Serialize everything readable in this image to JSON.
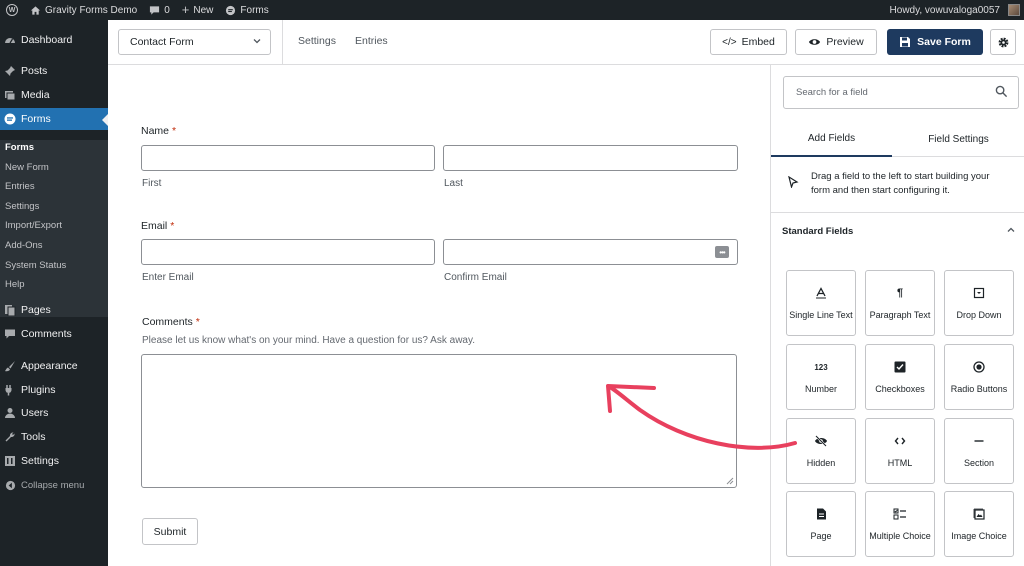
{
  "adminbar": {
    "site_name": "Gravity Forms Demo",
    "comments_count": "0",
    "new_label": "New",
    "forms_label": "Forms",
    "howdy": "Howdy, vowuvaloga0057"
  },
  "sidebar": {
    "items": [
      {
        "label": "Dashboard",
        "icon": "dashboard-icon"
      },
      {
        "label": "Posts",
        "icon": "pin-icon"
      },
      {
        "label": "Media",
        "icon": "media-icon"
      },
      {
        "label": "Forms",
        "icon": "forms-icon"
      },
      {
        "label": "Pages",
        "icon": "page-icon"
      },
      {
        "label": "Comments",
        "icon": "comment-icon"
      },
      {
        "label": "Appearance",
        "icon": "brush-icon"
      },
      {
        "label": "Plugins",
        "icon": "plugin-icon"
      },
      {
        "label": "Users",
        "icon": "user-icon"
      },
      {
        "label": "Tools",
        "icon": "wrench-icon"
      },
      {
        "label": "Settings",
        "icon": "settings-icon"
      }
    ],
    "submenu": [
      "Forms",
      "New Form",
      "Entries",
      "Settings",
      "Import/Export",
      "Add-Ons",
      "System Status",
      "Help"
    ],
    "collapse_label": "Collapse menu"
  },
  "toolbar": {
    "form_name": "Contact Form",
    "settings_label": "Settings",
    "entries_label": "Entries",
    "embed_label": "Embed",
    "preview_label": "Preview",
    "save_label": "Save Form"
  },
  "form": {
    "name_label": "Name",
    "first_label": "First",
    "last_label": "Last",
    "email_label": "Email",
    "enter_email_label": "Enter Email",
    "confirm_email_label": "Confirm Email",
    "comments_label": "Comments",
    "comments_desc": "Please let us know what's on your mind. Have a question for us? Ask away.",
    "required_mark": "*",
    "submit_label": "Submit"
  },
  "panel": {
    "search_placeholder": "Search for a field",
    "tab_add": "Add Fields",
    "tab_settings": "Field Settings",
    "hint": "Drag a field to the left to start building your form and then start configuring it.",
    "standard_fields_label": "Standard Fields",
    "fields": [
      {
        "label": "Single Line Text",
        "icon": "text-a-icon"
      },
      {
        "label": "Paragraph Text",
        "icon": "pilcrow-icon"
      },
      {
        "label": "Drop Down",
        "icon": "dropdown-icon"
      },
      {
        "label": "Number",
        "icon": "number-icon"
      },
      {
        "label": "Checkboxes",
        "icon": "checkbox-icon"
      },
      {
        "label": "Radio Buttons",
        "icon": "radio-icon"
      },
      {
        "label": "Hidden",
        "icon": "eye-slash-icon"
      },
      {
        "label": "HTML",
        "icon": "code-icon"
      },
      {
        "label": "Section",
        "icon": "section-icon"
      },
      {
        "label": "Page",
        "icon": "page-break-icon"
      },
      {
        "label": "Multiple Choice",
        "icon": "multiple-choice-icon"
      },
      {
        "label": "Image Choice",
        "icon": "image-icon"
      }
    ]
  },
  "colors": {
    "admin_dark": "#1d2327",
    "wp_blue": "#2271b1",
    "primary_navy": "#1e3a5f",
    "arrow_pink": "#e8405e",
    "required_red": "#c02b0a"
  }
}
